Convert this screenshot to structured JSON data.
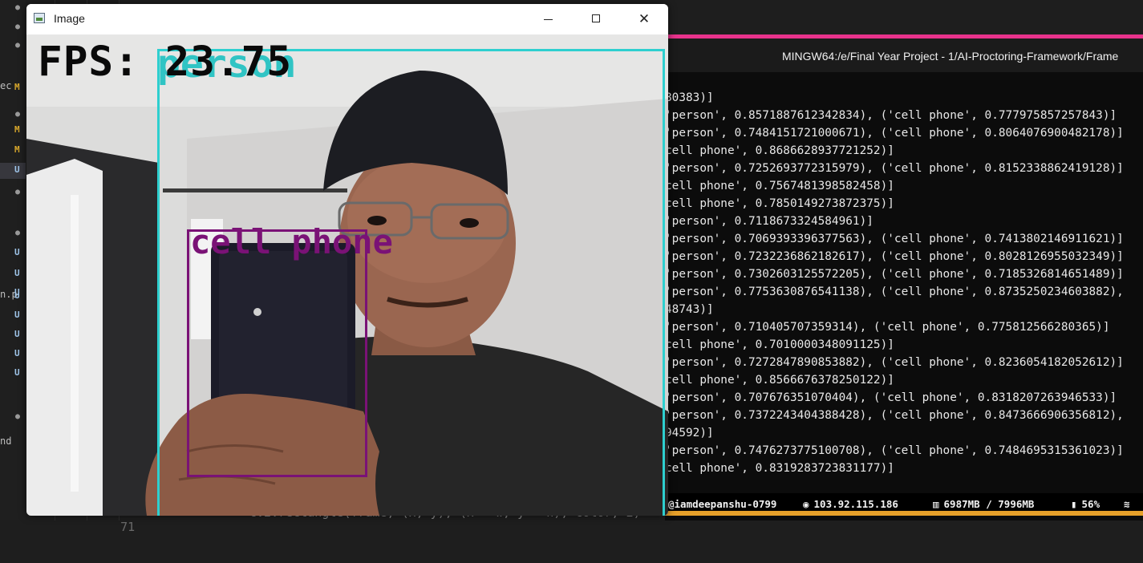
{
  "editor": {
    "gutter": [
      {
        "edge": "",
        "mark": "●",
        "kind": "dot"
      },
      {
        "edge": "",
        "mark": "●",
        "kind": "dot"
      },
      {
        "edge": "",
        "mark": "●",
        "kind": "dot"
      },
      {
        "edge": "ec",
        "mark": "M",
        "kind": "m"
      },
      {
        "edge": "",
        "mark": "●",
        "kind": "dot"
      },
      {
        "edge": "",
        "mark": "M",
        "kind": "m"
      },
      {
        "edge": "",
        "mark": "M",
        "kind": "m"
      },
      {
        "edge": "",
        "mark": "U",
        "kind": "u"
      },
      {
        "edge": "",
        "mark": "●",
        "kind": "dot"
      },
      {
        "edge": "",
        "mark": "●",
        "kind": "dot"
      },
      {
        "edge": "",
        "mark": "U",
        "kind": "u"
      },
      {
        "edge": "",
        "mark": "U",
        "kind": "u"
      },
      {
        "edge": "",
        "mark": "U",
        "kind": "u"
      },
      {
        "edge": "n.p",
        "mark": "U",
        "kind": "u"
      },
      {
        "edge": "",
        "mark": "U",
        "kind": "u"
      },
      {
        "edge": "",
        "mark": "U",
        "kind": "u"
      },
      {
        "edge": "",
        "mark": "U",
        "kind": "u"
      },
      {
        "edge": "",
        "mark": "U",
        "kind": "u"
      },
      {
        "edge": "",
        "mark": "●",
        "kind": "dot"
      },
      {
        "edge": "nd",
        "mark": "",
        "kind": "none"
      }
    ],
    "bottom_line_number": "71",
    "bottom_code": "cv2.rectangle(frame, (x, y), (x + w, y + h), color, 2)"
  },
  "terminal": {
    "title": "MINGW64:/e/Final Year Project - 1/AI-Proctoring-Framework/Frame",
    "lines": [
      "80383)]",
      "'person', 0.8571887612342834), ('cell phone', 0.777975857257843)]",
      "'person', 0.7484151721000671), ('cell phone', 0.8064076900482178)]",
      "cell phone', 0.8686628937721252)]",
      "'person', 0.7252693772315979), ('cell phone', 0.8152338862419128)]",
      "cell phone', 0.7567481398582458)]",
      "cell phone', 0.7850149273872375)]",
      "'person', 0.7118673324584961)]",
      "'person', 0.7069393396377563), ('cell phone', 0.7413802146911621)]",
      "'person', 0.7232236862182617), ('cell phone', 0.8028126955032349)]",
      "'person', 0.7302603125572205), ('cell phone', 0.7185326814651489)]",
      "'person', 0.7753630876541138), ('cell phone', 0.8735250234603882),",
      "48743)]",
      "'person', 0.710405707359314), ('cell phone', 0.775812566280365)]",
      "cell phone', 0.7010000348091125)]",
      "'person', 0.7272847890853882), ('cell phone', 0.8236054182052612)]",
      "cell phone', 0.8566676378250122)]",
      "'person', 0.707676351070404), ('cell phone', 0.8318207263946533)]",
      "'person', 0.7372243404388428), ('cell phone', 0.8473666906356812),",
      "94592)]",
      "'person', 0.7476273775100708), ('cell phone', 0.7484695315361023)]",
      "cell phone', 0.8319283723831177)]"
    ],
    "status": {
      "user": "@iamdeepanshu-0799",
      "ip": "103.92.115.186",
      "memory": "6987MB / 7996MB",
      "battery": "56%",
      "wifi_icon": "wifi-icon",
      "memory_icon": "memory-icon",
      "battery_icon": "battery-icon",
      "network_icon": "network-icon"
    },
    "accent_color": "#e8338c",
    "underline_color": "#e6a02a"
  },
  "image_window": {
    "title": "Image",
    "fps_text": "FPS: 23.75",
    "person_label": "person",
    "phone_label": "cell phone",
    "person_box_color": "#2ecfcf",
    "phone_box_color": "#7a1276"
  }
}
